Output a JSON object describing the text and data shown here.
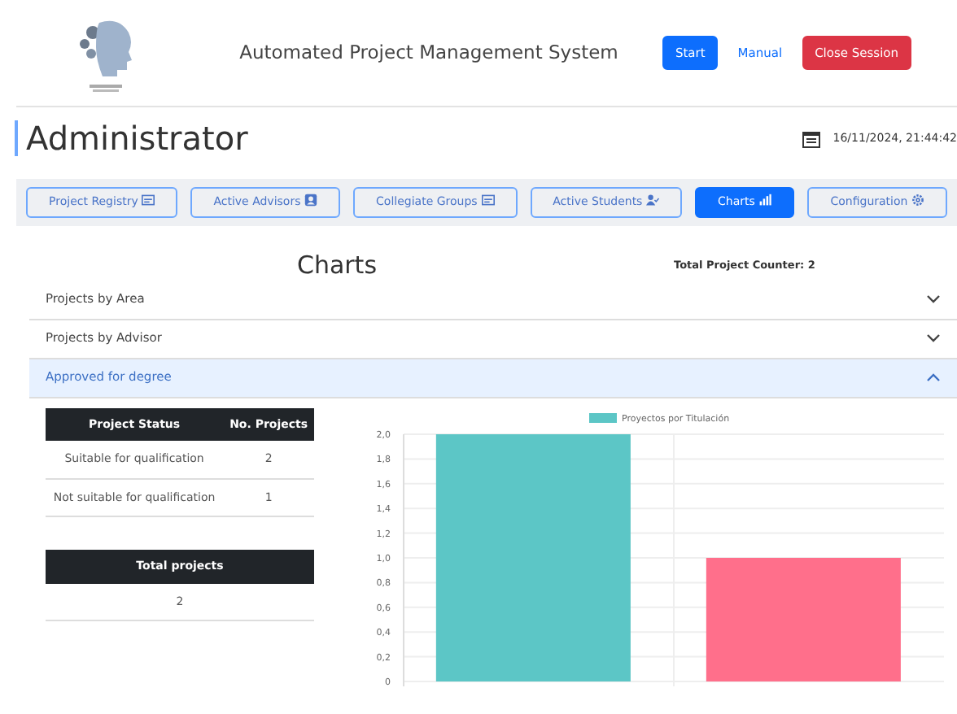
{
  "header": {
    "title": "Automated Project Management System",
    "buttons": [
      {
        "label": "Start",
        "kind": "primary"
      },
      {
        "label": "Manual",
        "kind": "link"
      },
      {
        "label": "Close Session",
        "kind": "danger"
      }
    ]
  },
  "page": {
    "title": "Administrator",
    "datetime": "16/11/2024, 21:44:42"
  },
  "nav": [
    {
      "label": "Project Registry",
      "selected": false
    },
    {
      "label": "Active Advisors",
      "selected": false
    },
    {
      "label": "Collegiate Groups",
      "selected": false
    },
    {
      "label": "Active Students",
      "selected": false
    },
    {
      "label": "Charts",
      "selected": true
    },
    {
      "label": "Configuration",
      "selected": false
    }
  ],
  "section": {
    "title": "Charts",
    "counter": "Total Project Counter: 2"
  },
  "accordion": [
    {
      "label": "Projects by Area",
      "expanded": false
    },
    {
      "label": "Projects by Advisor",
      "expanded": false
    },
    {
      "label": "Approved for degree",
      "expanded": true
    }
  ],
  "status_table": {
    "columns": [
      "Project Status",
      "No. Projects"
    ],
    "rows": [
      [
        "Suitable for qualification",
        "2"
      ],
      [
        "Not suitable for qualification",
        "1"
      ]
    ]
  },
  "total_table": {
    "columns": [
      "Total projects"
    ],
    "rows": [
      [
        "2"
      ]
    ]
  },
  "chart_data": {
    "type": "bar",
    "series": [
      {
        "name": "Proyectos por Titulación",
        "color": [
          "#5cc6c6",
          "#ff6f8b"
        ],
        "values": [
          2,
          1
        ]
      }
    ],
    "grid": true,
    "ylim": [
      0,
      2
    ],
    "yticks": [
      {
        "value": 0,
        "label": "0"
      },
      {
        "value": 0.2,
        "label": "0,2"
      },
      {
        "value": 0.4,
        "label": "0,4"
      },
      {
        "value": 0.6,
        "label": "0,6"
      },
      {
        "value": 0.8,
        "label": "0,8"
      },
      {
        "value": 1,
        "label": "1,0"
      },
      {
        "value": 1.2,
        "label": "1,2"
      },
      {
        "value": 1.4,
        "label": "1,4"
      },
      {
        "value": 1.6,
        "label": "1,6"
      },
      {
        "value": 1.8,
        "label": "1,8"
      },
      {
        "value": 2,
        "label": "2,0"
      }
    ]
  }
}
